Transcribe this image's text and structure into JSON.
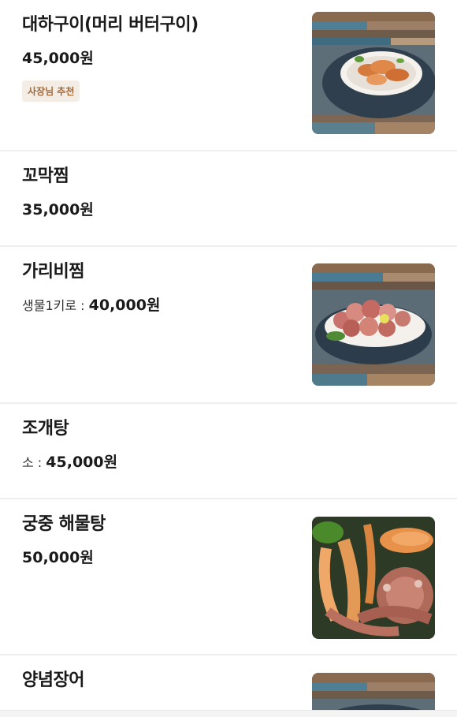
{
  "menu": [
    {
      "name": "대하구이(머리 버터구이)",
      "price": "45,000원",
      "badge": "사장님 추천",
      "image": "grilled-prawns-photo"
    },
    {
      "name": "꼬막찜",
      "price": "35,000원"
    },
    {
      "name": "가리비찜",
      "price_prefix": "생물1키로 : ",
      "price": "40,000원",
      "image": "steamed-scallops-photo"
    },
    {
      "name": "조개탕",
      "price_prefix": "소 : ",
      "price": "45,000원"
    },
    {
      "name": "궁중 해물탕",
      "price": "50,000원",
      "image": "seafood-stew-photo"
    },
    {
      "name": "양념장어",
      "image": "seasoned-eel-photo"
    }
  ]
}
